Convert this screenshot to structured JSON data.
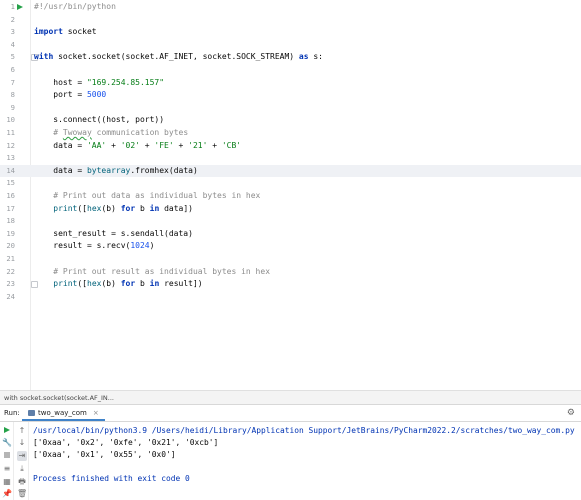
{
  "editor": {
    "lines": [
      {
        "n": "1",
        "html": "<span class=\"com\">#!/usr/bin/python</span>"
      },
      {
        "n": "2",
        "html": ""
      },
      {
        "n": "3",
        "html": "<span class=\"kw\">import</span> socket"
      },
      {
        "n": "4",
        "html": ""
      },
      {
        "n": "5",
        "html": "<span class=\"kw\">with</span> socket.socket(socket.AF_INET, socket.SOCK_STREAM) <span class=\"kw\">as</span> s:"
      },
      {
        "n": "6",
        "html": ""
      },
      {
        "n": "7",
        "html": "    host = <span class=\"str\">\"169.254.85.157\"</span>"
      },
      {
        "n": "8",
        "html": "    port = <span class=\"num\">5000</span>"
      },
      {
        "n": "9",
        "html": ""
      },
      {
        "n": "10",
        "html": "    s.connect((host, port))"
      },
      {
        "n": "11",
        "html": "    <span class=\"com\"># <span class=\"tilde\">Twoway</span> communication bytes</span>"
      },
      {
        "n": "12",
        "html": "    data = <span class=\"str\">'AA'</span> + <span class=\"str\">'02'</span> + <span class=\"str\">'FE'</span> + <span class=\"str\">'21'</span> + <span class=\"str\">'CB'</span>"
      },
      {
        "n": "13",
        "html": ""
      },
      {
        "n": "14",
        "html": "    data = <span class=\"fn\">bytearray</span>.fromhex(data)"
      },
      {
        "n": "15",
        "html": ""
      },
      {
        "n": "16",
        "html": "    <span class=\"com\"># Print out data as individual bytes in hex</span>"
      },
      {
        "n": "17",
        "html": "    <span class=\"fn\">print</span>([<span class=\"fn\">hex</span>(b) <span class=\"kw\">for</span> b <span class=\"kw\">in</span> data])"
      },
      {
        "n": "18",
        "html": ""
      },
      {
        "n": "19",
        "html": "    sent_result = s.sendall(data)"
      },
      {
        "n": "20",
        "html": "    result = s.recv(<span class=\"num\">1024</span>)"
      },
      {
        "n": "21",
        "html": ""
      },
      {
        "n": "22",
        "html": "    <span class=\"com\"># Print out result as individual bytes in hex</span>"
      },
      {
        "n": "23",
        "html": "    <span class=\"fn\">print</span>([<span class=\"fn\">hex</span>(b) <span class=\"kw\">for</span> b <span class=\"kw\">in</span> result])"
      },
      {
        "n": "24",
        "html": ""
      }
    ]
  },
  "breadcrumb": "with socket.socket(socket.AF_IN...",
  "run_panel": {
    "label": "Run:",
    "tab_name": "two_way_com",
    "close": "×",
    "settings_icon": "gear-icon",
    "output": [
      "/usr/local/bin/python3.9 /Users/heidi/Library/Application Support/JetBrains/PyCharm2022.2/scratches/two_way_com.py",
      "['0xaa', '0x2', '0xfe', '0x21', '0xcb']",
      "['0xaa', '0x1', '0x55', '0x0']",
      "",
      "Process finished with exit code 0"
    ]
  }
}
